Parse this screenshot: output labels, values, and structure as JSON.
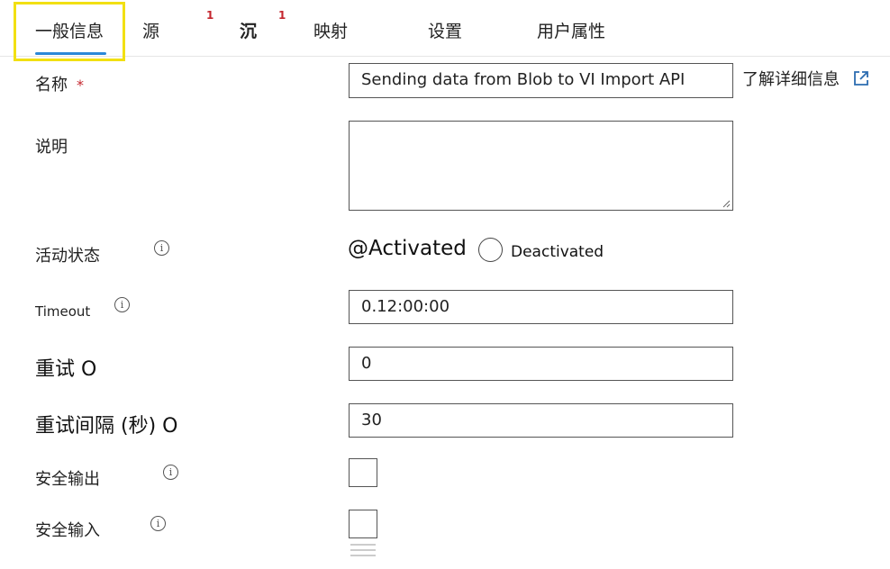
{
  "tabs": [
    {
      "label": "一般信息",
      "badge": ""
    },
    {
      "label": "源",
      "badge": "1"
    },
    {
      "label": "沉",
      "badge": "1"
    },
    {
      "label": "映射",
      "badge": ""
    },
    {
      "label": "设置",
      "badge": ""
    },
    {
      "label": "用户属性",
      "badge": ""
    }
  ],
  "form": {
    "name": {
      "label": "名称",
      "required_marker": "*",
      "value": "Sending data from Blob to VI Import API",
      "learn_more": "了解详细信息"
    },
    "description": {
      "label": "说明",
      "value": ""
    },
    "activity_state": {
      "label": "活动状态",
      "option_activated": "@Activated",
      "option_deactivated": "Deactivated"
    },
    "timeout": {
      "label": "Timeout",
      "value": "0.12:00:00"
    },
    "retry": {
      "label": "重试 O",
      "value": "0"
    },
    "retry_interval": {
      "label": "重试间隔 (秒) O",
      "value": "30"
    },
    "secure_output": {
      "label": "安全输出",
      "checked": false
    },
    "secure_input": {
      "label": "安全输入",
      "checked": false
    }
  },
  "icons": {
    "info": "i",
    "external_link": "external-link-icon"
  },
  "colors": {
    "accent": "#2b88d8",
    "highlight": "#f2e012",
    "badge": "#c4262e"
  }
}
